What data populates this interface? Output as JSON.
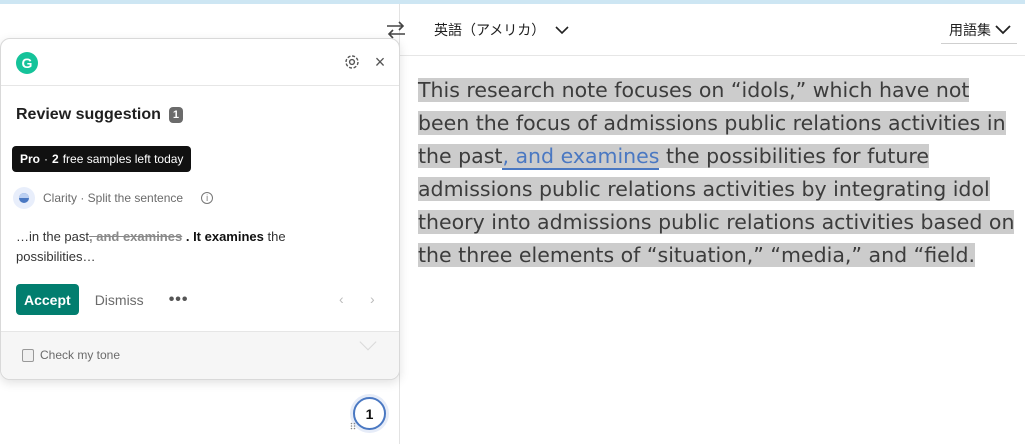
{
  "translator": {
    "target_language": "英語（アメリカ）",
    "glossary_label": "用語集",
    "translated_text": {
      "before": "This research note focuses on “idols,” which have not been the focus of admissions public relations activities in the past",
      "flagged": ", and examines",
      "after": " the possibilities for future admissions public relations activities by integrating idol theory into admissions public relations activities based on the three elements of “situation,” “media,” and “field."
    }
  },
  "grammarly": {
    "logo_letter": "G",
    "review_title": "Review suggestion",
    "review_count": "1",
    "pro_label": "Pro",
    "pro_separator": "·",
    "pro_samples_count": "2",
    "pro_samples_text": "free samples left today",
    "category": "Clarity · Split the sentence",
    "suggestion": {
      "prefix": "…in the past",
      "removed": ", and examines",
      "inserted": ". It examines",
      "suffix": " the possibilities…"
    },
    "accept_label": "Accept",
    "dismiss_label": "Dismiss",
    "more_label": "•••",
    "prev_label": "‹",
    "next_label": "›",
    "tone_label": "Check my tone",
    "counter": "1"
  },
  "colors": {
    "accept": "#027e6f",
    "brand": "#15c39a",
    "highlight": "#cccccc",
    "flag_underline": "#4a78c2"
  }
}
